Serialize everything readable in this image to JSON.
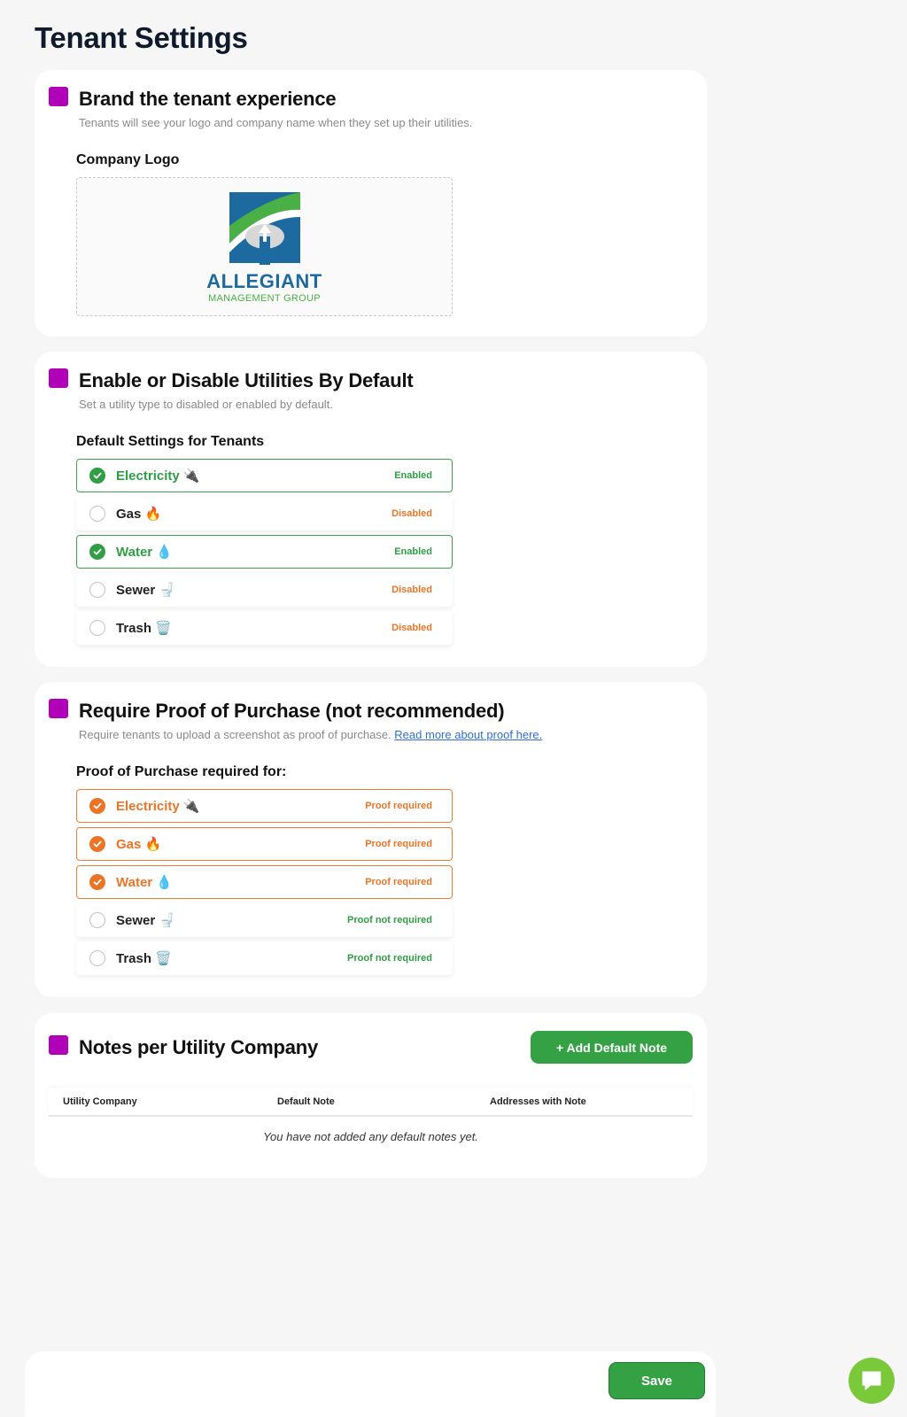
{
  "page": {
    "title": "Tenant Settings"
  },
  "brand": {
    "title": "Brand the tenant experience",
    "description": "Tenants will see your logo and company name when they set up their utilities.",
    "logo_label": "Company Logo",
    "logo_text": "ALLEGIANT",
    "logo_subtext": "MANAGEMENT GROUP",
    "colors": {
      "blue": "#1d6aa0",
      "green": "#49b046"
    }
  },
  "defaults": {
    "title": "Enable or Disable Utilities By Default",
    "description": "Set a utility type to disabled or enabled by default.",
    "list_label": "Default Settings for Tenants",
    "items": [
      {
        "label": "Electricity 🔌",
        "status": "Enabled",
        "checked": true
      },
      {
        "label": "Gas 🔥",
        "status": "Disabled",
        "checked": false
      },
      {
        "label": "Water 💧",
        "status": "Enabled",
        "checked": true
      },
      {
        "label": "Sewer 🚽",
        "status": "Disabled",
        "checked": false
      },
      {
        "label": "Trash 🗑️",
        "status": "Disabled",
        "checked": false
      }
    ]
  },
  "proof": {
    "title": "Require Proof of Purchase (not recommended)",
    "description": "Require tenants to upload a screenshot as proof of purchase.",
    "link_text": "Read more about proof here.",
    "list_label": "Proof of Purchase required for:",
    "items": [
      {
        "label": "Electricity 🔌",
        "status": "Proof required",
        "checked": true
      },
      {
        "label": "Gas 🔥",
        "status": "Proof required",
        "checked": true
      },
      {
        "label": "Water 💧",
        "status": "Proof required",
        "checked": true
      },
      {
        "label": "Sewer 🚽",
        "status": "Proof not required",
        "checked": false
      },
      {
        "label": "Trash 🗑️",
        "status": "Proof not required",
        "checked": false
      }
    ]
  },
  "notes": {
    "title": "Notes per Utility Company",
    "add_button": "+ Add Default Note",
    "columns": [
      "Utility Company",
      "Default Note",
      "Addresses with Note"
    ],
    "empty_text": "You have not added any default notes yet."
  },
  "footer": {
    "save_label": "Save"
  },
  "theme": {
    "accent": "#b000b8",
    "green": "#34a244",
    "orange": "#ec7425"
  }
}
